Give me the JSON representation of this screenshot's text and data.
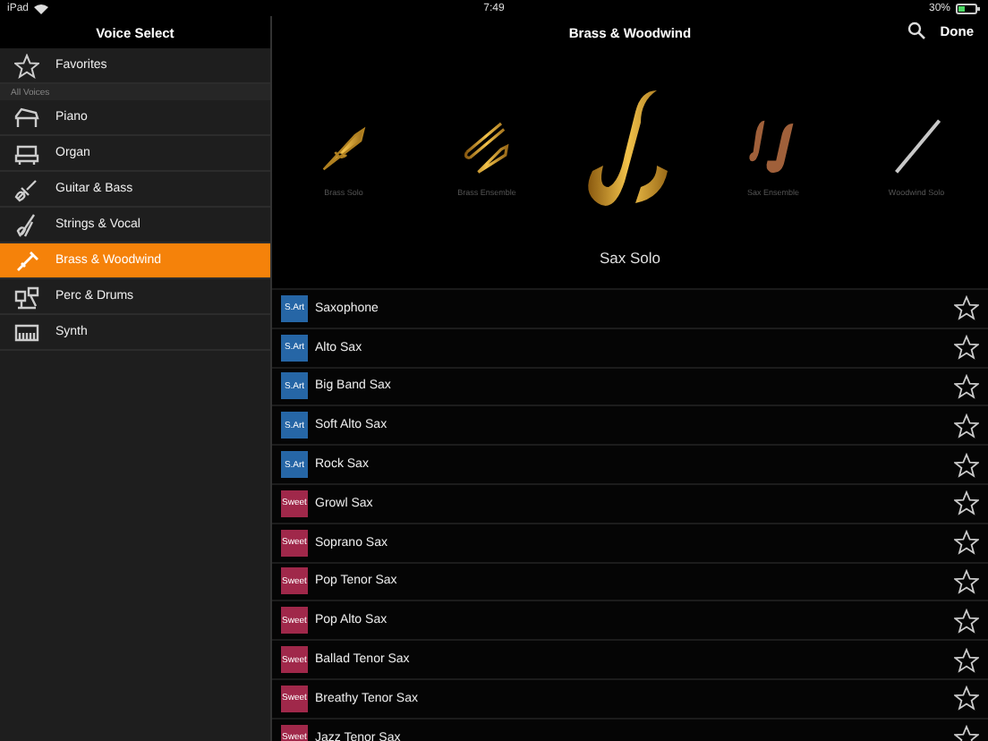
{
  "status_bar": {
    "device": "iPad",
    "time": "7:49",
    "battery": "30%"
  },
  "sidebar": {
    "title": "Voice Select",
    "favorites": {
      "label": "Favorites",
      "selected": false
    },
    "section": "All Voices",
    "items": [
      {
        "label": "Piano",
        "kind": "piano",
        "selected": false
      },
      {
        "label": "Organ",
        "kind": "organ",
        "selected": false
      },
      {
        "label": "Guitar & Bass",
        "kind": "guitar",
        "selected": false
      },
      {
        "label": "Strings & Vocal",
        "kind": "strings",
        "selected": false
      },
      {
        "label": "Brass & Woodwind",
        "kind": "brass",
        "selected": true
      },
      {
        "label": "Perc & Drums",
        "kind": "drums",
        "selected": false
      },
      {
        "label": "Synth",
        "kind": "synth",
        "selected": false
      }
    ]
  },
  "main": {
    "title": "Brass & Woodwind",
    "done": "Done",
    "carousel": [
      {
        "label": "Brass Solo",
        "kind": "trumpet",
        "selected": false
      },
      {
        "label": "Brass Ensemble",
        "kind": "trombone",
        "selected": false
      },
      {
        "label": "Sax Solo",
        "kind": "sax",
        "selected": true
      },
      {
        "label": "Sax Ensemble",
        "kind": "saxes",
        "selected": false
      },
      {
        "label": "Woodwind Solo",
        "kind": "flute",
        "selected": false
      }
    ],
    "voices": [
      {
        "badge": "S.Art",
        "kind": "sart",
        "name": "Saxophone",
        "favorite": false
      },
      {
        "badge": "S.Art",
        "kind": "sart",
        "name": "Alto Sax",
        "favorite": false
      },
      {
        "badge": "S.Art",
        "kind": "sart",
        "name": "Big Band Sax",
        "favorite": false
      },
      {
        "badge": "S.Art",
        "kind": "sart",
        "name": "Soft Alto Sax",
        "favorite": false
      },
      {
        "badge": "S.Art",
        "kind": "sart",
        "name": "Rock Sax",
        "favorite": false
      },
      {
        "badge": "Sweet",
        "kind": "sweet",
        "name": "Growl Sax",
        "favorite": false
      },
      {
        "badge": "Sweet",
        "kind": "sweet",
        "name": "Soprano Sax",
        "favorite": false
      },
      {
        "badge": "Sweet",
        "kind": "sweet",
        "name": "Pop Tenor Sax",
        "favorite": false
      },
      {
        "badge": "Sweet",
        "kind": "sweet",
        "name": "Pop Alto Sax",
        "favorite": false
      },
      {
        "badge": "Sweet",
        "kind": "sweet",
        "name": "Ballad Tenor Sax",
        "favorite": false
      },
      {
        "badge": "Sweet",
        "kind": "sweet",
        "name": "Breathy Tenor Sax",
        "favorite": false
      },
      {
        "badge": "Sweet",
        "kind": "sweet",
        "name": "Jazz Tenor Sax",
        "favorite": false
      }
    ]
  }
}
